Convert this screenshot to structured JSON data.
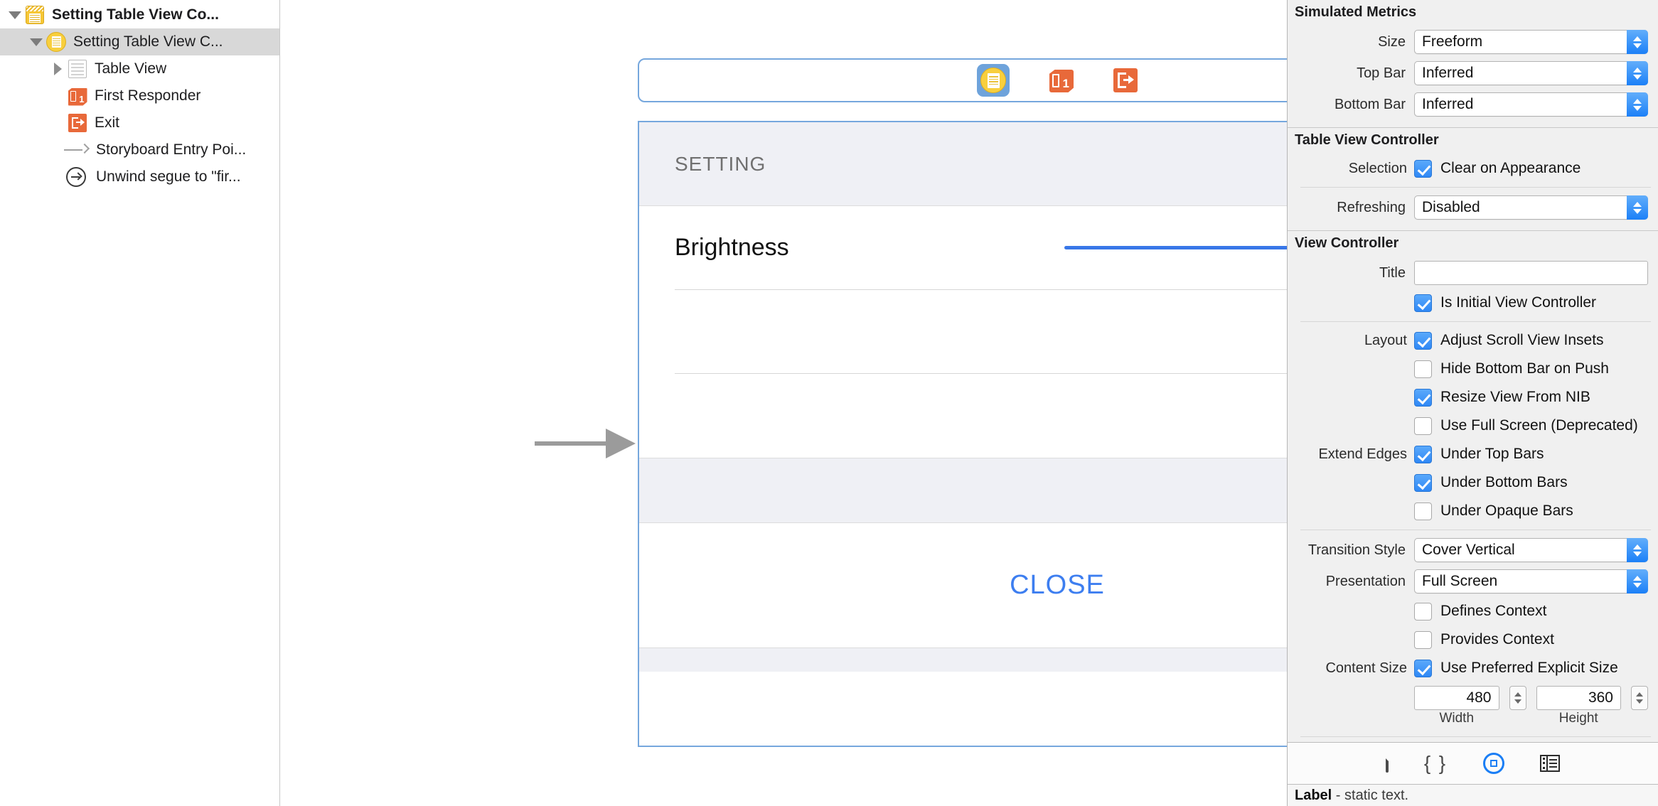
{
  "outline": {
    "items": [
      {
        "label": "Setting Table View Co...",
        "icon": "view-controller-scene-icon",
        "disclosure": "down",
        "indent": 0,
        "selected": false,
        "bold": true
      },
      {
        "label": "Setting Table View C...",
        "icon": "table-view-controller-icon",
        "disclosure": "down",
        "indent": 1,
        "selected": true,
        "bold": false
      },
      {
        "label": "Table View",
        "icon": "table-view-icon",
        "disclosure": "right",
        "indent": 2,
        "selected": false,
        "bold": false
      },
      {
        "label": "First Responder",
        "icon": "first-responder-icon",
        "disclosure": "none",
        "indent": 2,
        "selected": false,
        "bold": false
      },
      {
        "label": "Exit",
        "icon": "exit-icon",
        "disclosure": "none",
        "indent": 2,
        "selected": false,
        "bold": false
      },
      {
        "label": "Storyboard Entry Poi...",
        "icon": "storyboard-entry-point-icon",
        "disclosure": "none",
        "indent": 2,
        "selected": false,
        "bold": false
      },
      {
        "label": "Unwind segue to \"fir...",
        "icon": "unwind-segue-icon",
        "disclosure": "none",
        "indent": 2,
        "selected": false,
        "bold": false
      }
    ]
  },
  "canvas": {
    "dock_icons": [
      {
        "name": "view-controller-icon",
        "selected": true
      },
      {
        "name": "first-responder-icon",
        "selected": false
      },
      {
        "name": "exit-icon",
        "selected": false
      }
    ],
    "section_header": "SETTING",
    "cells": [
      {
        "label": "Brightness",
        "control": "slider"
      }
    ],
    "close_button": "CLOSE",
    "accent_color": "#3d7ef0",
    "slider_color": "#3877e8"
  },
  "inspector": {
    "simulated_metrics": {
      "title": "Simulated Metrics",
      "rows": [
        {
          "label": "Size",
          "value": "Freeform"
        },
        {
          "label": "Top Bar",
          "value": "Inferred"
        },
        {
          "label": "Bottom Bar",
          "value": "Inferred"
        }
      ]
    },
    "table_view_controller": {
      "title": "Table View Controller",
      "selection_label": "Selection",
      "selection_checkbox": {
        "text": "Clear on Appearance",
        "checked": true
      },
      "refreshing_label": "Refreshing",
      "refreshing_value": "Disabled"
    },
    "view_controller": {
      "title": "View Controller",
      "title_label": "Title",
      "title_value": "",
      "is_initial": {
        "text": "Is Initial View Controller",
        "checked": true
      },
      "layout_label": "Layout",
      "layout_checks": [
        {
          "text": "Adjust Scroll View Insets",
          "checked": true
        },
        {
          "text": "Hide Bottom Bar on Push",
          "checked": false
        },
        {
          "text": "Resize View From NIB",
          "checked": true
        },
        {
          "text": "Use Full Screen (Deprecated)",
          "checked": false
        }
      ],
      "extend_edges_label": "Extend Edges",
      "extend_checks": [
        {
          "text": "Under Top Bars",
          "checked": true
        },
        {
          "text": "Under Bottom Bars",
          "checked": true
        },
        {
          "text": "Under Opaque Bars",
          "checked": false
        }
      ],
      "transition_style_label": "Transition Style",
      "transition_style_value": "Cover Vertical",
      "presentation_label": "Presentation",
      "presentation_value": "Full Screen",
      "context_checks": [
        {
          "text": "Defines Context",
          "checked": false
        },
        {
          "text": "Provides Context",
          "checked": false
        }
      ],
      "content_size_label": "Content Size",
      "content_size_check": {
        "text": "Use Preferred Explicit Size",
        "checked": true
      },
      "width_value": "480",
      "height_value": "360",
      "width_caption": "Width",
      "height_caption": "Height"
    },
    "footer": {
      "icons": [
        {
          "name": "file-inspector-icon",
          "active": false
        },
        {
          "name": "quick-help-braces-icon",
          "active": false
        },
        {
          "name": "identity-inspector-icon",
          "active": true
        },
        {
          "name": "attributes-inspector-icon",
          "active": false
        }
      ],
      "description_strong": "Label",
      "description_rest": " - static text."
    }
  }
}
